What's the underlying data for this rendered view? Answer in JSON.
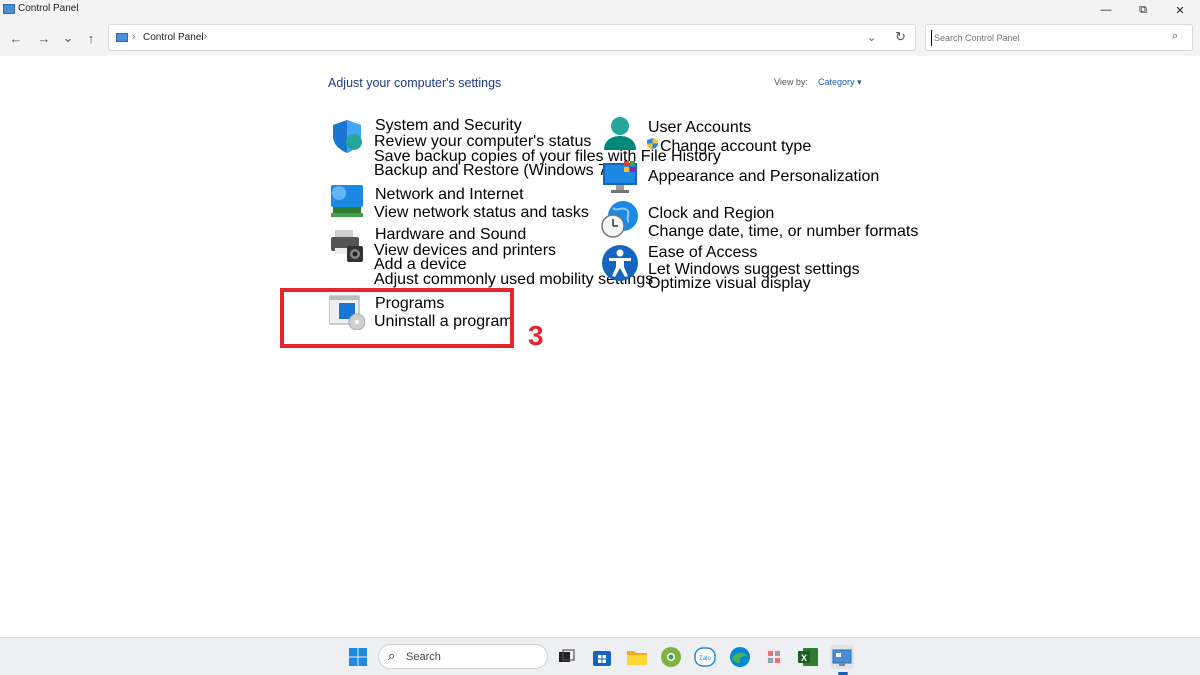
{
  "window": {
    "title": "Control Panel",
    "controls": {
      "minimize": "—",
      "maximize": "⧉",
      "close": "✕"
    }
  },
  "nav": {
    "back": "←",
    "forward": "→",
    "recent": "⌄",
    "up": "↑"
  },
  "address": {
    "separator": "›",
    "crumb": "Control Panel",
    "dropdown": "⌄",
    "refresh": "↻"
  },
  "search": {
    "placeholder": "Search Control Panel",
    "icon": "search-icon"
  },
  "main": {
    "heading": "Adjust your computer's settings",
    "view_by_label": "View by:",
    "view_by_value": "Category ▾"
  },
  "categories_left": [
    {
      "title": "System and Security",
      "icon": "shield-icon",
      "links": [
        "Review your computer's status",
        "Save backup copies of your files with File History",
        "Backup and Restore (Windows 7)"
      ]
    },
    {
      "title": "Network and Internet",
      "icon": "network-icon",
      "links": [
        "View network status and tasks"
      ]
    },
    {
      "title": "Hardware and Sound",
      "icon": "printer-icon",
      "links": [
        "View devices and printers",
        "Add a device",
        "Adjust commonly used mobility settings"
      ]
    },
    {
      "title": "Programs",
      "icon": "programs-icon",
      "links": [
        "Uninstall a program"
      ]
    }
  ],
  "categories_right": [
    {
      "title": "User Accounts",
      "icon": "user-icon",
      "links": [
        "Change account type"
      ]
    },
    {
      "title": "Appearance and Personalization",
      "icon": "monitor-icon",
      "links": []
    },
    {
      "title": "Clock and Region",
      "icon": "clock-globe-icon",
      "links": [
        "Change date, time, or number formats"
      ]
    },
    {
      "title": "Ease of Access",
      "icon": "accessibility-icon",
      "links": [
        "Let Windows suggest settings",
        "Optimize visual display"
      ]
    }
  ],
  "annotation": {
    "step": "3",
    "color": "#e3262b"
  },
  "taskbar": {
    "search_label": "Search",
    "apps": [
      "start-icon",
      "task-view-icon",
      "store-icon",
      "file-explorer-icon",
      "chrome-icon",
      "zalo-icon",
      "edge-icon",
      "snipping-icon",
      "excel-icon",
      "control-panel-icon"
    ]
  },
  "colors": {
    "title_green": "#1f7a1f",
    "link_blue": "#1a5fb4",
    "heading_blue": "#1e3a8a"
  }
}
